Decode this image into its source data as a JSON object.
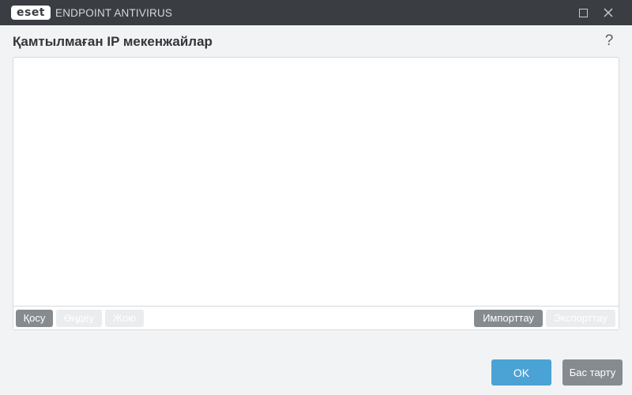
{
  "window": {
    "logo_text": "eset",
    "product_name": "ENDPOINT ANTIVIRUS"
  },
  "dialog": {
    "title": "Қамтылмаған IP мекенжайлар",
    "help_label": "?"
  },
  "list": {
    "rows": [],
    "toolbar": {
      "add_label": "Қосу",
      "edit_label": "Өңдеу",
      "delete_label": "Жою",
      "import_label": "Импорттау",
      "export_label": "Экспорттау"
    }
  },
  "footer": {
    "ok_label": "OK",
    "cancel_label": "Бас тарту"
  },
  "colors": {
    "titlebar": "#3a3d41",
    "primary_button": "#4aa3d4",
    "secondary_button": "#868b90",
    "disabled_button": "#ebeced"
  }
}
